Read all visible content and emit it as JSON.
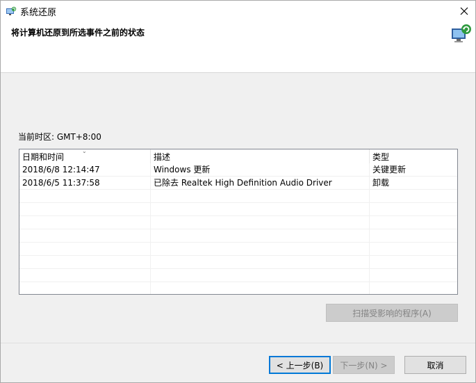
{
  "window": {
    "title": "系统还原",
    "heading": "将计算机还原到所选事件之前的状态"
  },
  "timezone": "当前时区: GMT+8:00",
  "table": {
    "columns": [
      "日期和时间",
      "描述",
      "类型"
    ],
    "rows": [
      {
        "date": "2018/6/8 12:14:47",
        "description": "Windows 更新",
        "type": "关键更新"
      },
      {
        "date": "2018/6/5 11:37:58",
        "description": "已除去 Realtek High Definition Audio Driver",
        "type": "卸载"
      }
    ]
  },
  "buttons": {
    "scan": "扫描受影响的程序(A)",
    "back": "< 上一步(B)",
    "next": "下一步(N) >",
    "cancel": "取消"
  },
  "colors": {
    "accent": "#0078d7",
    "disabled_text": "#838383"
  },
  "icons": {
    "title": "system-restore-icon",
    "close": "close-icon",
    "header": "system-restore-icon"
  }
}
